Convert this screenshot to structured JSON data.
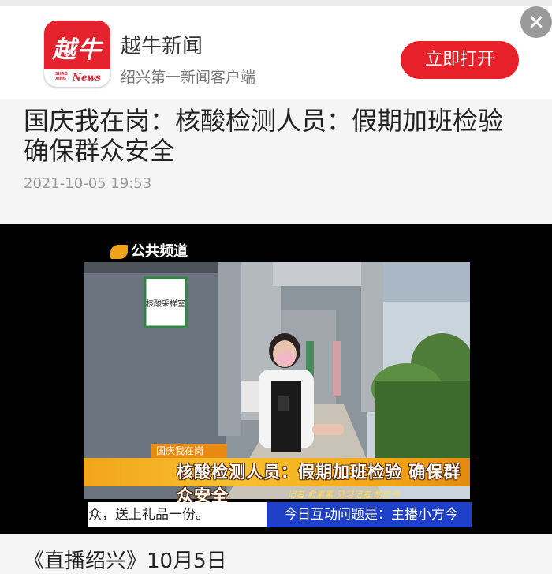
{
  "app_banner": {
    "logo_chars": "越牛",
    "logo_sub_small": "SHAO XING",
    "logo_sub_news": "News",
    "app_name": "越牛新闻",
    "app_subtitle": "绍兴第一新闻客户端",
    "open_button": "立即打开",
    "close_icon": "×"
  },
  "article": {
    "title": "国庆我在岗：核酸检测人员：假期加班检验 确保群众安全",
    "date": "2021-10-05 19:53",
    "next_line": "《直播绍兴》10月5日"
  },
  "video": {
    "channel_logo": "公共频道",
    "sign_text": "核酸采样室",
    "lower_third_tag": "国庆我在岗",
    "headline": "核酸检测人员：假期加班检验  确保群众安全",
    "credit": "记者 俞素素 见习记者 胡宏舟",
    "ticker_left": "众，送上礼品一份。",
    "ticker_right": "今日互动问题是：主播小方今"
  },
  "colors": {
    "brand_red": "#e8202a",
    "ticker_blue": "#1e40c8",
    "lower_third_orange": "#f3a51a"
  }
}
